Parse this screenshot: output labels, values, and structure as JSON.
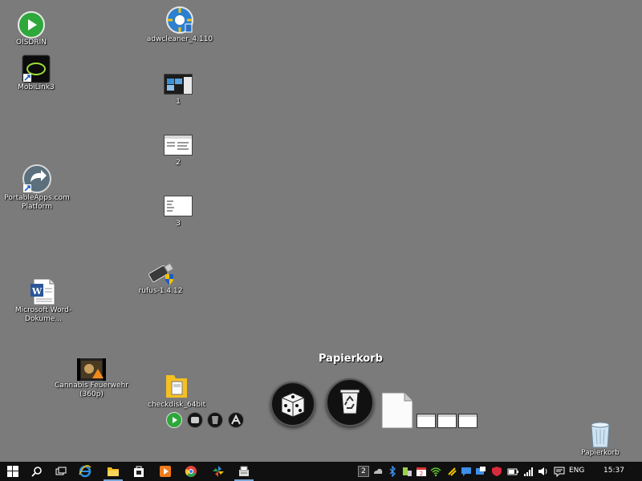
{
  "desktop": {
    "background_color": "#7b7b7b",
    "icons": [
      {
        "id": "oisdrin",
        "label": "OISDRIN",
        "icon": "play-circle-icon"
      },
      {
        "id": "mobilink",
        "label": "MobiLink3",
        "icon": "mobilink-shortcut-icon"
      },
      {
        "id": "portableapps",
        "label": "PortableApps.com Platform",
        "icon": "portableapps-shortcut-icon"
      },
      {
        "id": "word-doc",
        "label": "Microsoft Word-Dokume...",
        "icon": "word-document-icon"
      },
      {
        "id": "cannabis",
        "label": "Cannabis Feuerwehr (360p)",
        "icon": "video-file-icon"
      },
      {
        "id": "adwcleaner",
        "label": "adwcleaner_4.110",
        "icon": "adwcleaner-icon"
      },
      {
        "id": "shot1",
        "label": "1",
        "icon": "screenshot-thumbnail-icon"
      },
      {
        "id": "shot2",
        "label": "2",
        "icon": "screenshot-thumbnail-icon"
      },
      {
        "id": "shot3",
        "label": "3",
        "icon": "screenshot-thumbnail-icon"
      },
      {
        "id": "rufus",
        "label": "rufus-1.4.12",
        "icon": "rufus-usb-icon"
      },
      {
        "id": "checkdisk",
        "label": "checkdisk_64bit",
        "icon": "checkdisk-icon"
      },
      {
        "id": "recycle",
        "label": "Papierkorb",
        "icon": "recycle-bin-icon"
      }
    ]
  },
  "dock": {
    "title": "Papierkorb",
    "items": [
      "dice-icon",
      "recycle-icon",
      "document-icon"
    ]
  },
  "taskbar": {
    "language": "ENG",
    "clock": "15:37",
    "tray_badge": "2",
    "accent": "#7aa7d8"
  }
}
